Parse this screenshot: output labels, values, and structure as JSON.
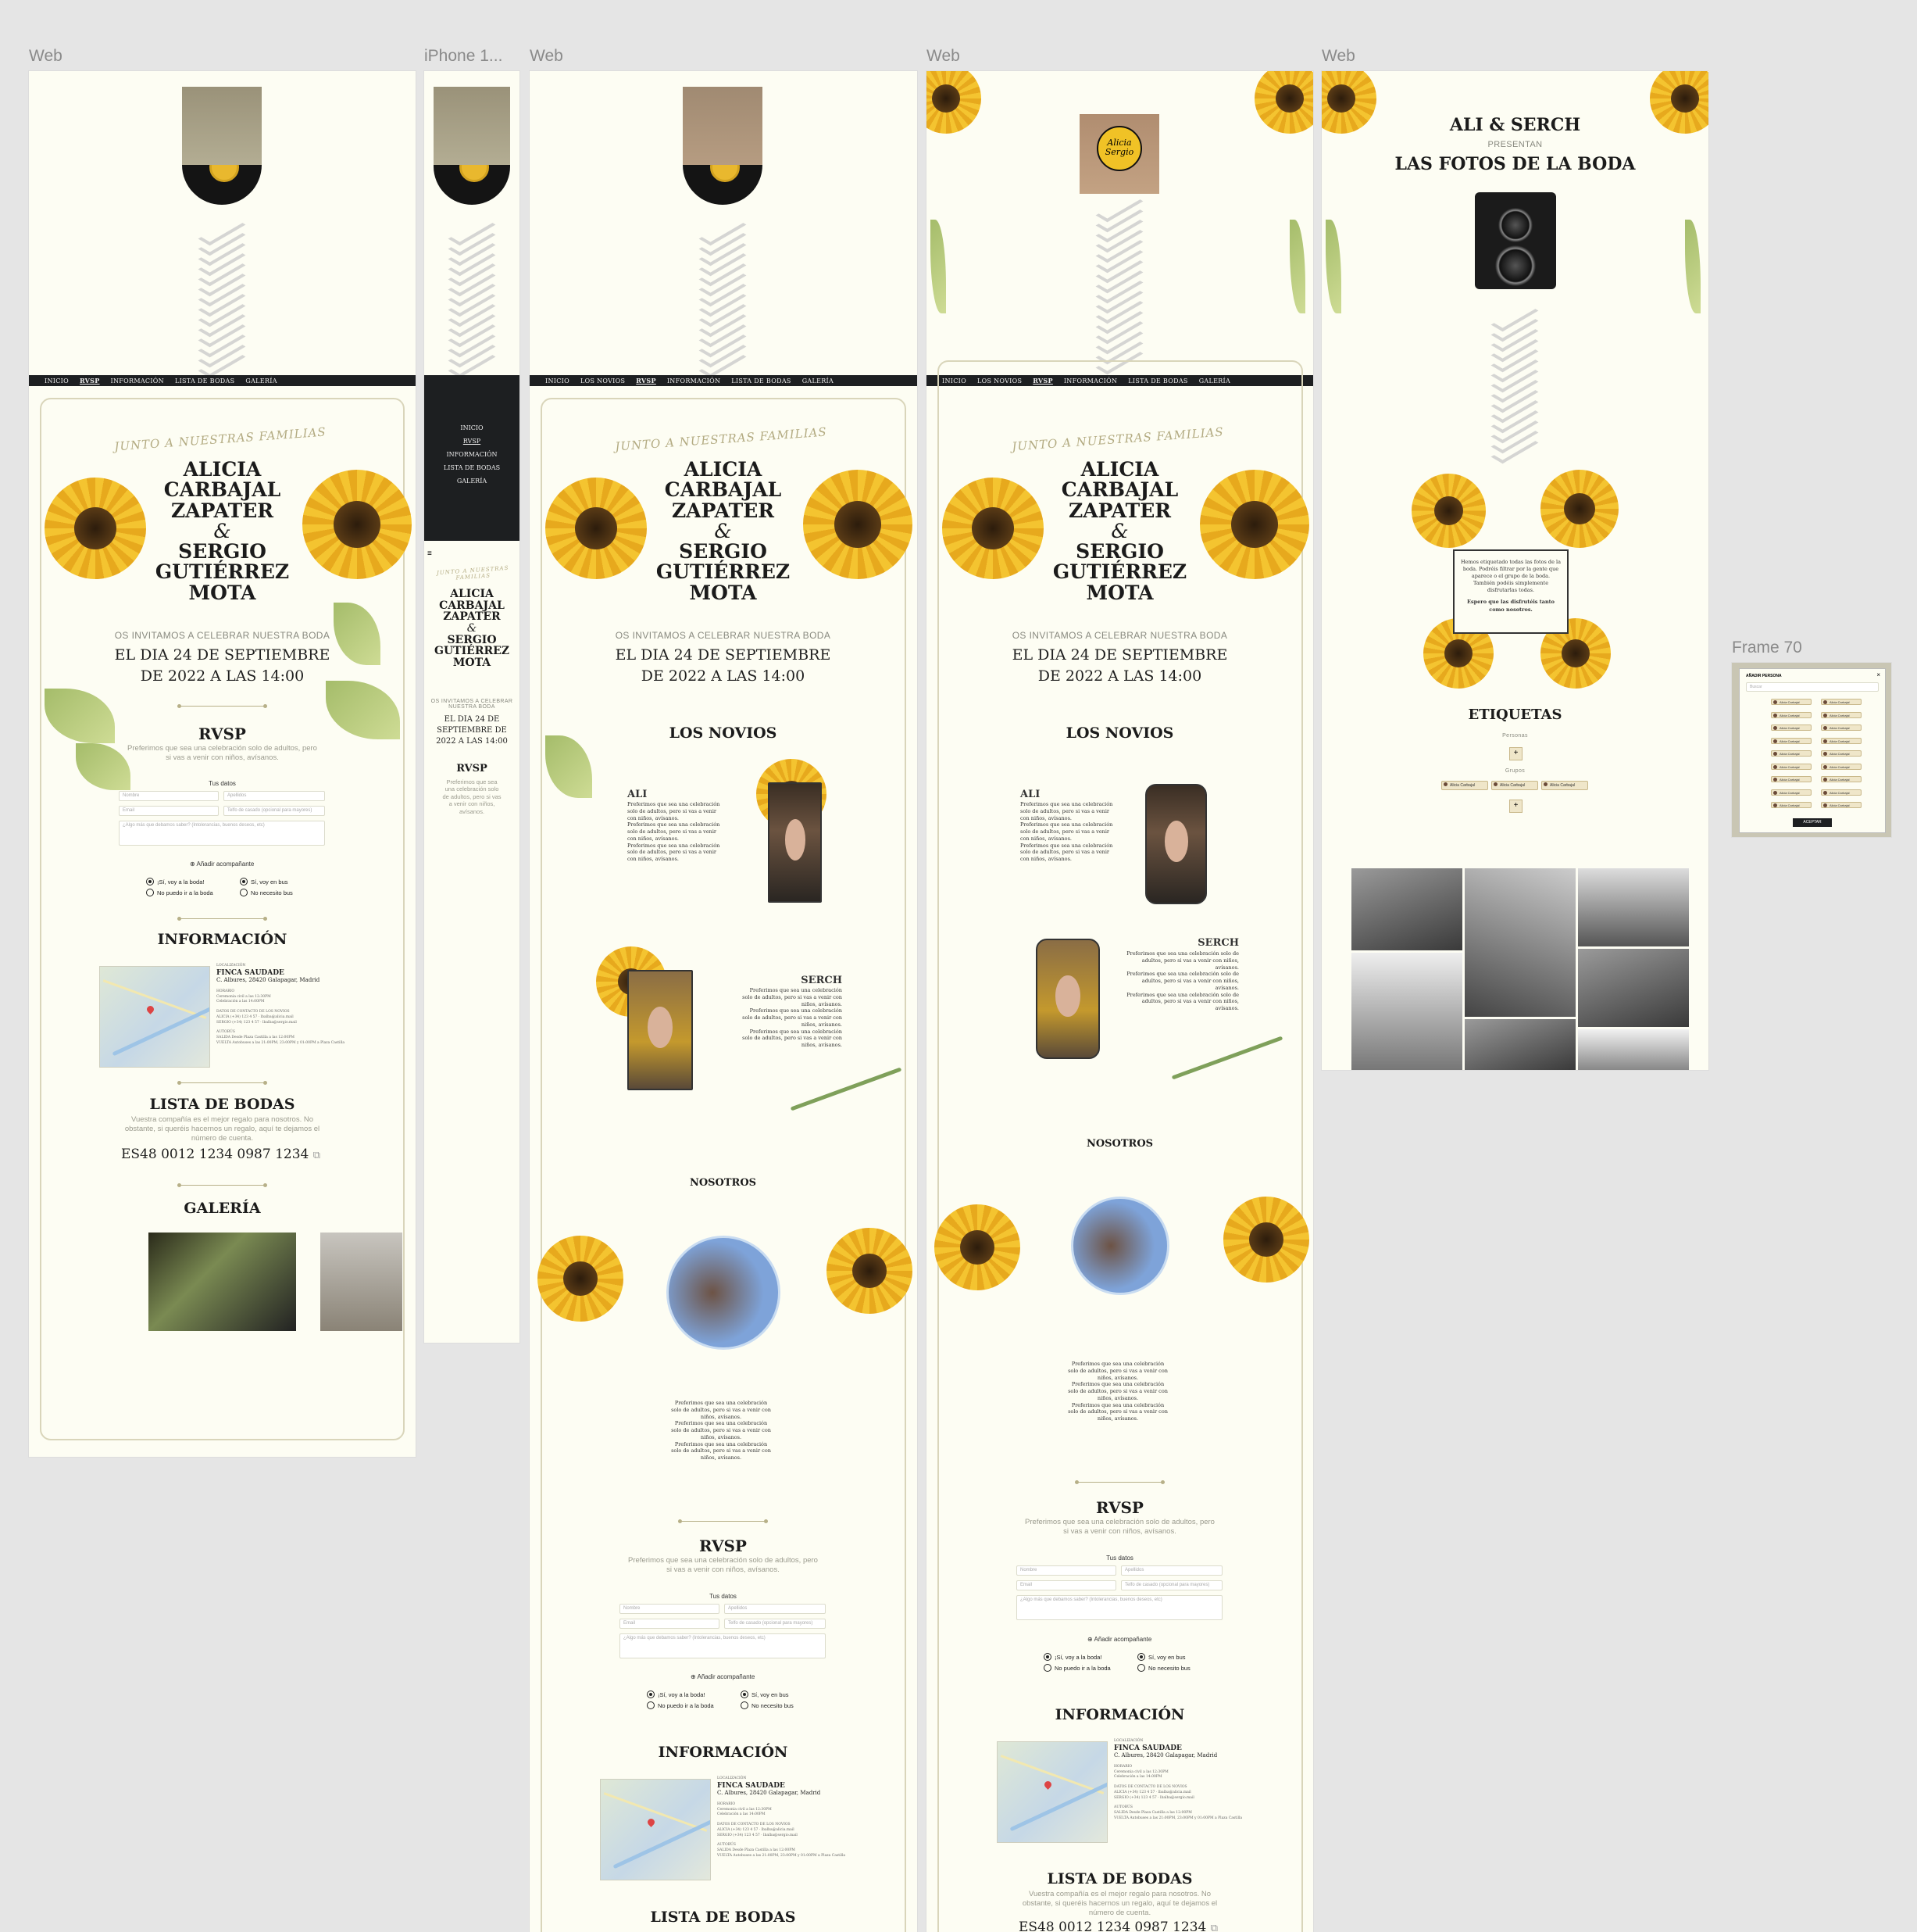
{
  "canvas": {
    "background": "#e5e5e5"
  },
  "frames": {
    "f1_label": "Web",
    "f2_label": "iPhone 1...",
    "f3_label": "Web",
    "f4_label": "Web",
    "f5_label": "Web",
    "f6_label": "Frame 70"
  },
  "nav": {
    "inicio": "INICIO",
    "novios": "LOS NOVIOS",
    "rvsp": "RVSP",
    "informacion": "INFORMACIÓN",
    "lista": "LISTA DE BODAS",
    "galeria": "GALERÍA"
  },
  "mobile_menu_icon": "≡",
  "invitation": {
    "script": "JUNTO A NUESTRAS FAMILIAS",
    "bride": [
      "ALICIA",
      "CARBAJAL",
      "ZAPATER"
    ],
    "amp": "&",
    "groom": [
      "SERGIO",
      "GUTIÉRREZ",
      "MOTA"
    ],
    "invite": "OS INVITAMOS A CELEBRAR NUESTRA BODA",
    "date_line1": "EL DIA 24 DE SEPTIEMBRE",
    "date_line2": "DE 2022 A LAS 14:00",
    "date_mobile": [
      "EL DIA 24 DE",
      "SEPTIEMBRE DE",
      "2022 A LAS 14:00"
    ],
    "invite_mobile": [
      "OS INVITAMOS A CELEBRAR",
      "NUESTRA BODA"
    ]
  },
  "rvsp": {
    "title": "RVSP",
    "desc_line1": "Preferimos que sea una celebración solo de adultos, pero",
    "desc_line2": "si vas a venir con niños, avísanos.",
    "desc_mobile": [
      "Preferimos que sea",
      "una celebración solo",
      "de adultos, pero si vas",
      "a venir con niños,",
      "avísanos."
    ],
    "tus_datos": "Tus datos",
    "nombre": "Nombre",
    "apellidos": "Apellidos",
    "email": "Email",
    "telefono": "Telfo de casado (opcional para mayores)",
    "mensaje": "¿Algo más que debamos saber? (Intolerancias, buenos deseos, etc)",
    "add_companion": "⊕ Añadir acompañante",
    "voy": "¡Sí, voy a la boda!",
    "no_puedo": "No puedo ir a la boda",
    "bus": "Sí, voy en bus",
    "no_bus": "No necesito bus"
  },
  "informacion": {
    "title": "INFORMACIÓN",
    "loc_label": "LOCALIZACIÓN",
    "venue": "FINCA SAUDADE",
    "address": "C. Albures, 28420 Galapagar, Madrid",
    "horario_label": "HORARIO",
    "horario1": "Ceremonia civil a las 12:30PM",
    "horario2": "Celebración a las 14:00PM",
    "contacto_label": "DATOS DE CONTACTO DE LOS NOVIOS",
    "alicia": "ALICIA   (+34) 123 4 57 · lbalba@alicia.mail",
    "sergio": "SERGIO   (+34) 123 4 57 · lbalba@sergio.mail",
    "autobus_label": "AUTOBÚS",
    "salida": "SALIDA   Desde Plaza Castilla a las 12:00PM",
    "vuelta": "VUELTA   Autobuses a las 21:00PM, 23:00PM y 01:00PM a Plaza Castilla"
  },
  "lista": {
    "title": "LISTA DE BODAS",
    "desc": [
      "Vuestra compañía es el mejor regalo para nosotros. No",
      "obstante, si queréis hacernos un regalo, aquí te dejamos el",
      "número de cuenta."
    ],
    "iban": "ES48 0012 1234 0987 1234",
    "copy_icon": "⧉"
  },
  "galeria": {
    "title": "GALERÍA"
  },
  "novios": {
    "title": "LOS NOVIOS",
    "ali": "ALI",
    "serch": "SERCH",
    "nosotros": "NOSOTROS",
    "lorem1": "Preferimos que sea una celebración solo de adultos, pero si vas a venir con niños, avísanos.",
    "lorem2": "Preferimos que sea una celebración solo de adultos, pero si vas a venir con niños, avísanos.",
    "lorem3": "Preferimos que sea una celebración solo de adultos, pero si vas a venir con niños, avísanos."
  },
  "fotos": {
    "title1": "ALI & SERCH",
    "presentan": "PRESENTAN",
    "title2": "LAS FOTOS DE LA BODA",
    "card_text": "Hemos etiquetado todas las fotos de la boda. Podréis filtrar por la gente que aparece o el grupo de la boda. También podéis simplemente disfrutarlas todas.",
    "card_text2": "Espero que las disfrutéis tanto como nosotros.",
    "etiquetas": "ETIQUETAS",
    "personas": "Personas",
    "grupos": "Grupos",
    "chip": "Alicia Carbajal",
    "plus": "+"
  },
  "logo": {
    "line1": "Alicia",
    "line2": "Sergio"
  },
  "popup": {
    "title": "AÑADIR PERSONA",
    "close": "×",
    "search": "Buscar",
    "chip": "Alicia Carbajal",
    "accept": "ACEPTAR"
  }
}
